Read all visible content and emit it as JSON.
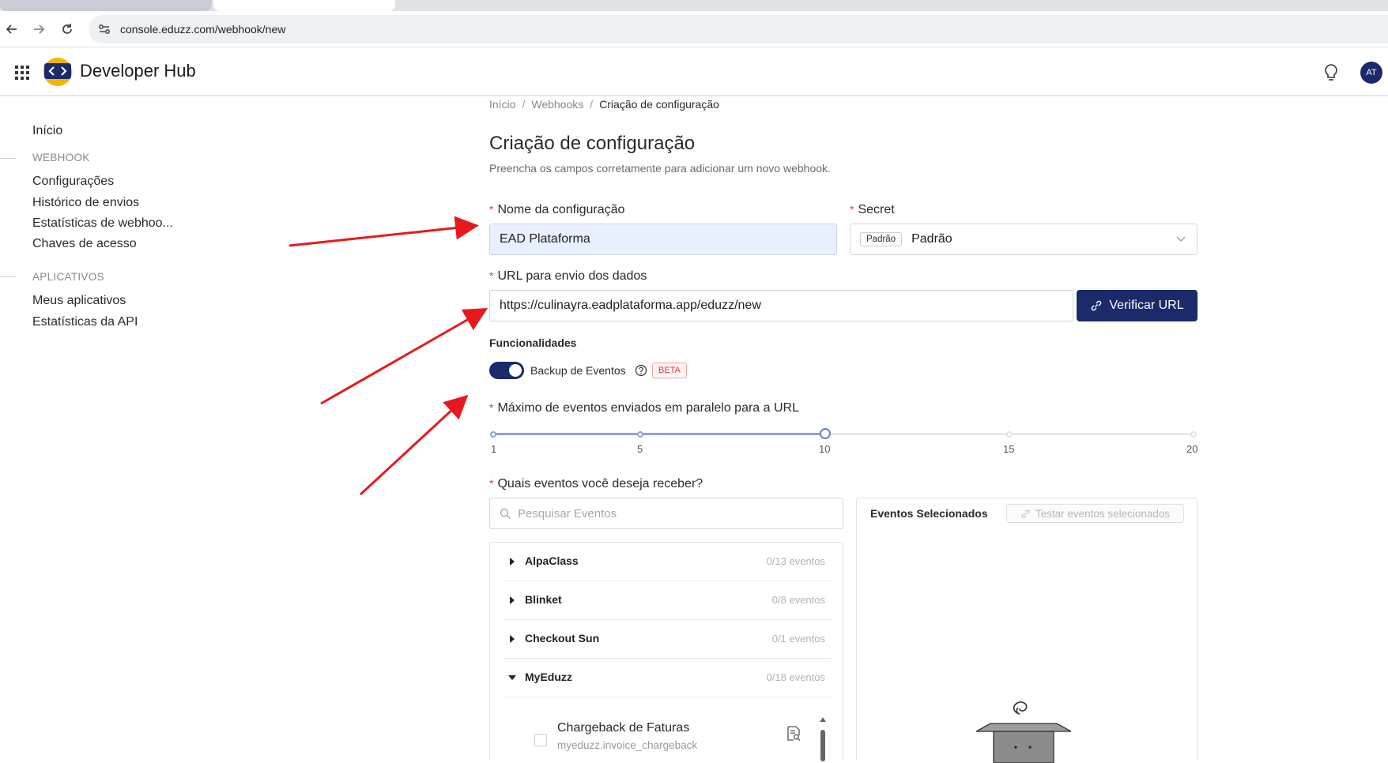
{
  "browser": {
    "url": "console.eduzz.com/webhook/new"
  },
  "header": {
    "brand": "Developer Hub",
    "avatar_initials": "AT"
  },
  "sidebar": {
    "home": "Início",
    "section_webhook": "WEBHOOK",
    "webhook_items": [
      "Configurações",
      "Histórico de envios",
      "Estatísticas de webhoo...",
      "Chaves de acesso"
    ],
    "section_apps": "APLICATIVOS",
    "app_items": [
      "Meus aplicativos",
      "Estatísticas da API"
    ]
  },
  "breadcrumb": {
    "items": [
      "Início",
      "Webhooks",
      "Criação de configuração"
    ],
    "separator": "/"
  },
  "page": {
    "title": "Criação de configuração",
    "subtitle": "Preencha os campos corretamente para adicionar um novo webhook."
  },
  "form": {
    "required_mark": "*",
    "name_label": "Nome da configuração",
    "name_value": "EAD Plataforma",
    "secret_label": "Secret",
    "secret_tag": "Padrão",
    "secret_value": "Padrão",
    "url_label": "URL para envio dos dados",
    "url_value": "https://culinayra.eadplataforma.app/eduzz/new",
    "verify_button": "Verificar URL",
    "functionalities_label": "Funcionalidades",
    "backup_toggle_label": "Backup de Eventos",
    "backup_toggle_on": true,
    "beta_badge": "BETA",
    "parallel_label": "Máximo de eventos enviados em paralelo para a URL",
    "slider": {
      "min": 1,
      "max": 20,
      "value": 10,
      "ticks": [
        "1",
        "5",
        "10",
        "15",
        "20"
      ]
    },
    "events_label": "Quais eventos você deseja receber?",
    "search_placeholder": "Pesquisar Eventos"
  },
  "events": {
    "groups": [
      {
        "name": "AlpaClass",
        "count": "0/13 eventos",
        "expanded": false
      },
      {
        "name": "Blinket",
        "count": "0/8 eventos",
        "expanded": false
      },
      {
        "name": "Checkout Sun",
        "count": "0/1 eventos",
        "expanded": false
      },
      {
        "name": "MyEduzz",
        "count": "0/18 eventos",
        "expanded": true
      }
    ],
    "item": {
      "title": "Chargeback de Faturas",
      "code": "myeduzz.invoice_chargeback"
    }
  },
  "selected": {
    "title": "Eventos Selecionados",
    "test_button": "Testar eventos selecionados"
  },
  "colors": {
    "primary": "#1b2a6b",
    "required": "#e53935",
    "slider": "#8fa2d6",
    "annotation_arrow": "#e8191c"
  }
}
